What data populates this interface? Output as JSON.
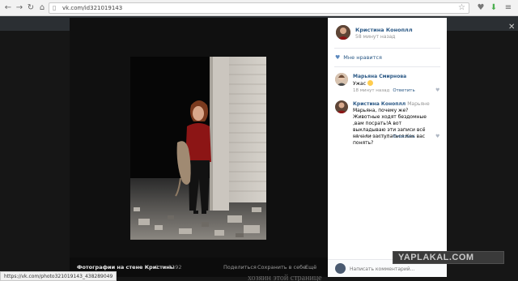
{
  "browser": {
    "url": "vk.com/id321019143",
    "back_icon": "back-arrow-icon",
    "forward_icon": "forward-arrow-icon",
    "reload_icon": "reload-icon",
    "home_icon": "home-icon"
  },
  "photo": {
    "caption": "Фотографии на стене Кристины",
    "counter": "2 из 1192",
    "actions": [
      "Поделиться",
      "Сохранить в себе",
      "Ещё"
    ]
  },
  "post": {
    "author": "Кристина Коноплл",
    "time": "58 минут назад",
    "like_label": "Мне нравится"
  },
  "comments": [
    {
      "name": "Марьяна Смирнова",
      "mention": "",
      "text": "Ужас",
      "time": "18 минут назад",
      "reply": "Ответить"
    },
    {
      "name": "Кристина Коноплл",
      "mention": "Марьяне",
      "text": "Марьяна, почему же?Животные ходят бездомные ,вам посрать!А вот выкладываю эти записи всё начали заступаться.Как вас понять?",
      "time": "18 минут назад",
      "reply": "Ответить"
    }
  ],
  "comment_input": {
    "placeholder": "Написать комментарий..."
  },
  "watermark": "YAPLAKAL.COM",
  "status_url": "https://vk.com/photo321019143_438289049",
  "underlay_text": "хозяин этой странице"
}
